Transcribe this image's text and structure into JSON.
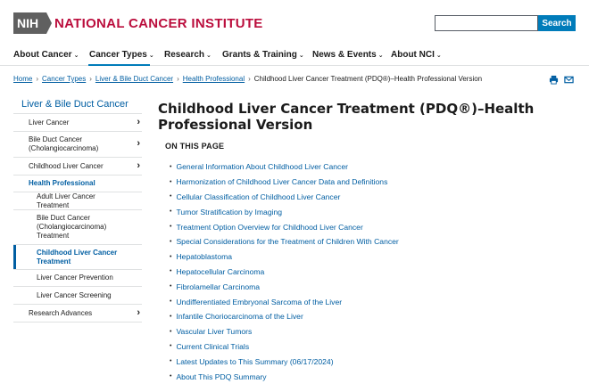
{
  "header": {
    "logo_mark": "NIH",
    "logo_text": "NATIONAL CANCER INSTITUTE",
    "search_placeholder": "",
    "search_button": "Search"
  },
  "nav": {
    "items": [
      {
        "label": "About Cancer"
      },
      {
        "label": "Cancer Types",
        "active": true
      },
      {
        "label": "Research"
      },
      {
        "label": "Grants & Training"
      },
      {
        "label": "News & Events"
      },
      {
        "label": "About NCI"
      }
    ]
  },
  "breadcrumb": {
    "items": [
      "Home",
      "Cancer Types",
      "Liver & Bile Duct Cancer",
      "Health Professional"
    ],
    "current": "Childhood Liver Cancer Treatment (PDQ®)–Health Professional Version"
  },
  "utility": {
    "print_icon": "print-icon",
    "email_icon": "email-icon"
  },
  "sidebar": {
    "title": "Liver & Bile Duct Cancer",
    "items": [
      {
        "label": "Liver Cancer",
        "chevron": true
      },
      {
        "label": "Bile Duct Cancer (Cholangiocarcinoma)",
        "chevron": true
      },
      {
        "label": "Childhood Liver Cancer",
        "chevron": true
      },
      {
        "label": "Health Professional"
      },
      {
        "label": "Adult Liver Cancer Treatment"
      },
      {
        "label": "Bile Duct Cancer (Cholangiocarcinoma) Treatment"
      },
      {
        "label": "Childhood Liver Cancer Treatment",
        "current": true
      },
      {
        "label": "Liver Cancer Prevention"
      },
      {
        "label": "Liver Cancer Screening"
      },
      {
        "label": "Research Advances",
        "chevron": true
      }
    ]
  },
  "main": {
    "title": "Childhood Liver Cancer Treatment (PDQ®)–Health Professional Version",
    "on_this_page": "ON THIS PAGE",
    "toc": [
      "General Information About Childhood Liver Cancer",
      "Harmonization of Childhood Liver Cancer Data and Definitions",
      "Cellular Classification of Childhood Liver Cancer",
      "Tumor Stratification by Imaging",
      "Treatment Option Overview for Childhood Liver Cancer",
      "Special Considerations for the Treatment of Children With Cancer",
      "Hepatoblastoma",
      "Hepatocellular Carcinoma",
      "Fibrolamellar Carcinoma",
      "Undifferentiated Embryonal Sarcoma of the Liver",
      "Infantile Choriocarcinoma of the Liver",
      "Vascular Liver Tumors",
      "Current Clinical Trials",
      "Latest Updates to This Summary (06/17/2024)",
      "About This PDQ Summary"
    ]
  },
  "colors": {
    "brand_red": "#bb0e3d",
    "link_blue": "#005ea2",
    "button_blue": "#007cba",
    "nih_gray": "#606060"
  }
}
